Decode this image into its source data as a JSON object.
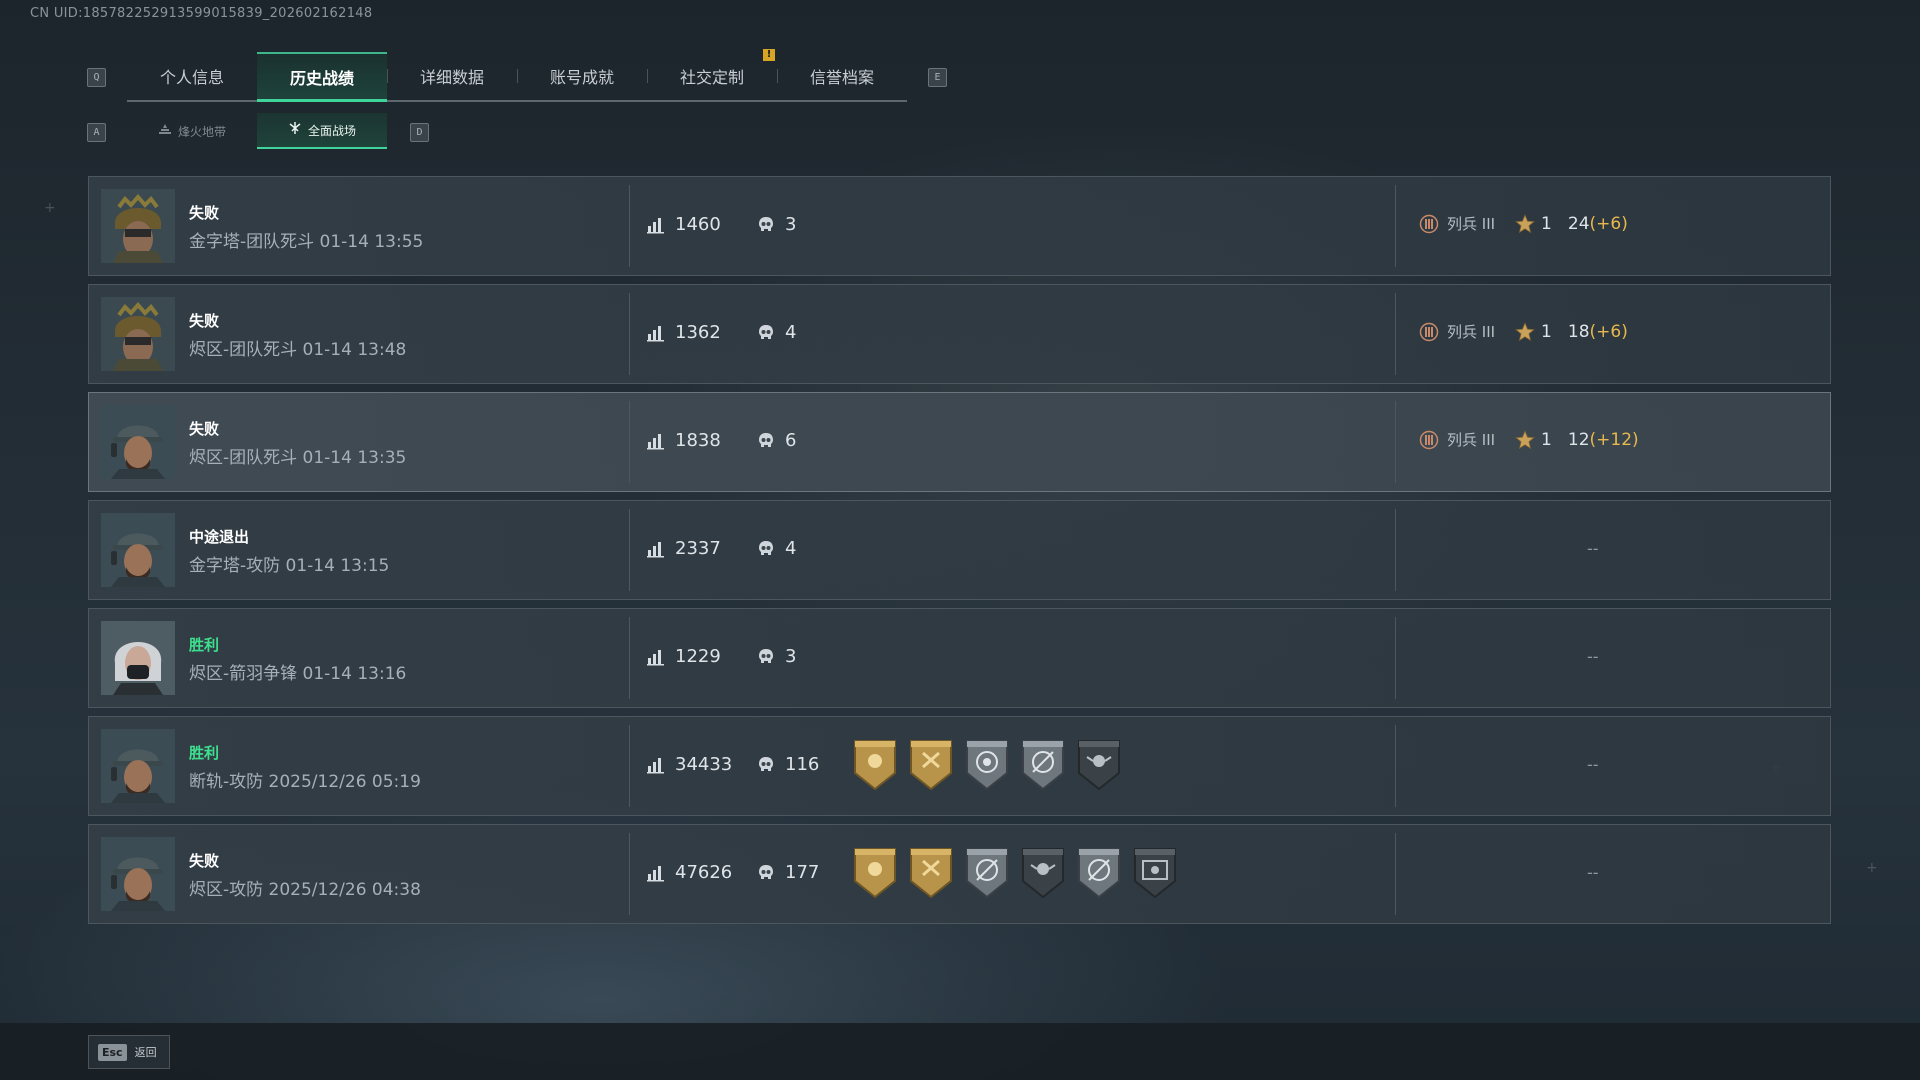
{
  "uid": "CN UID:185782252913599015839_202602162148",
  "tabs": {
    "left_key": "Q",
    "right_key": "E",
    "items": [
      {
        "label": "个人信息"
      },
      {
        "label": "历史战绩"
      },
      {
        "label": "详细数据"
      },
      {
        "label": "账号成就"
      },
      {
        "label": "社交定制"
      },
      {
        "label": "信誉档案"
      }
    ],
    "notice_mark": "!"
  },
  "subtabs": {
    "left_key": "A",
    "right_key": "D",
    "items": [
      {
        "label": "烽火地带",
        "icon": "beacon-icon"
      },
      {
        "label": "全面战场",
        "icon": "battlefield-icon"
      }
    ]
  },
  "matches": [
    {
      "result": "失败",
      "mode": "金字塔-团队死斗 01-14 13:55",
      "score": "1460",
      "kills": "3",
      "rank_name": "列兵 III",
      "stars": "1",
      "exp": "24",
      "exp_gain": "(+6)",
      "avatar": "camo-helmet"
    },
    {
      "result": "失败",
      "mode": "烬区-团队死斗 01-14 13:48",
      "score": "1362",
      "kills": "4",
      "rank_name": "列兵 III",
      "stars": "1",
      "exp": "18",
      "exp_gain": "(+6)",
      "avatar": "camo-helmet"
    },
    {
      "result": "失败",
      "mode": "烬区-团队死斗 01-14 13:35",
      "score": "1838",
      "kills": "6",
      "rank_name": "列兵 III",
      "stars": "1",
      "exp": "12",
      "exp_gain": "(+12)",
      "avatar": "cap-headset"
    },
    {
      "result": "中途退出",
      "mode": "金字塔-攻防 01-14 13:15",
      "score": "2337",
      "kills": "4",
      "empty": "--",
      "avatar": "cap-headset"
    },
    {
      "result": "胜利",
      "mode": "烬区-箭羽争锋 01-14 13:16",
      "score": "1229",
      "kills": "3",
      "empty": "--",
      "avatar": "white-hair-mask"
    },
    {
      "result": "胜利",
      "mode": "断轨-攻防 2025/12/26 05:19",
      "score": "34433",
      "kills": "116",
      "empty": "--",
      "avatar": "cap-headset",
      "badges": [
        "gold-skull-wreath-badge",
        "gold-hammer-badge",
        "silver-target-skull-badge",
        "silver-crosshair-badge",
        "dark-skull-wings-badge"
      ]
    },
    {
      "result": "失败",
      "mode": "烬区-攻防 2025/12/26 04:38",
      "score": "47626",
      "kills": "177",
      "empty": "--",
      "avatar": "cap-headset",
      "badges": [
        "gold-skull-wreath-badge",
        "gold-hammer-badge",
        "silver-crosshair-badge",
        "dark-skull-wings-badge",
        "silver-crosshair-badge",
        "dark-eye-target-badge"
      ]
    }
  ],
  "footer": {
    "esc_key": "Esc",
    "back_label": "返回"
  },
  "colors": {
    "accent": "#3fd49a",
    "win": "#3ee08f",
    "gold": "#e7b84d",
    "notice": "#d8a424"
  }
}
